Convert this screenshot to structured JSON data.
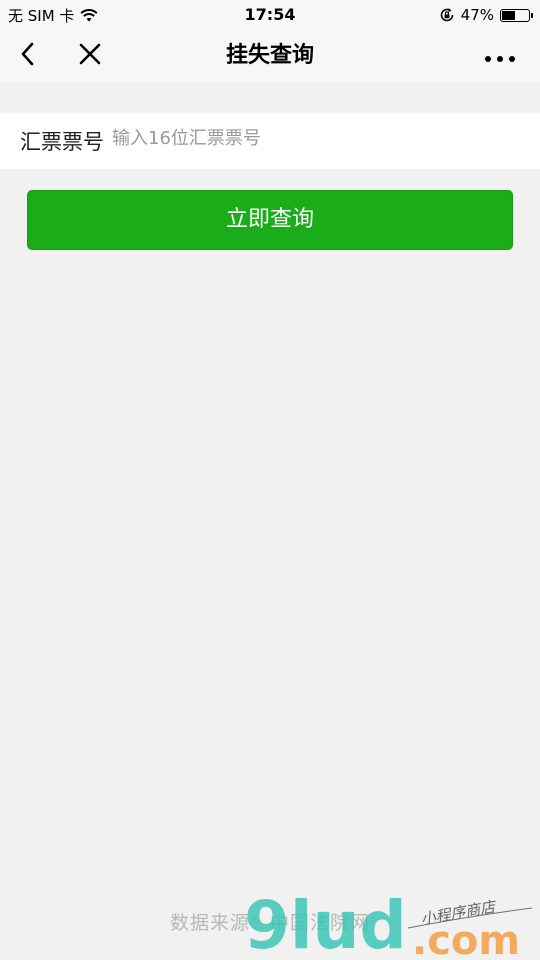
{
  "status_bar": {
    "carrier": "无 SIM 卡",
    "time": "17:54",
    "battery_percent": "47%",
    "battery_level": 0.47
  },
  "nav": {
    "title": "挂失查询",
    "back_icon": "chevron-left-icon",
    "close_icon": "close-icon",
    "more_icon": "more-dots-icon"
  },
  "form": {
    "label": "汇票票号",
    "placeholder": "输入16位汇票票号",
    "value": ""
  },
  "actions": {
    "query_label": "立即查询"
  },
  "footer": {
    "source_text": "数据来源：中国法院网"
  },
  "watermark": {
    "brand": "9lud",
    "domain": ".com",
    "tagline": "小程序商店"
  },
  "colors": {
    "primary_green": "#1aad19",
    "background": "#f1f1f1"
  }
}
